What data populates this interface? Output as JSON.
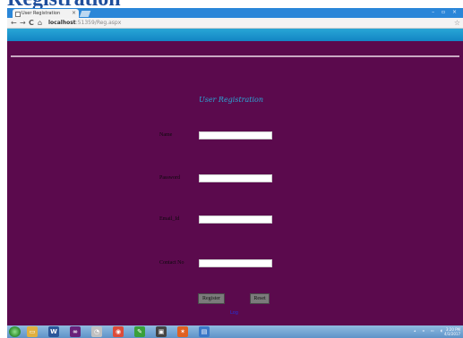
{
  "document": {
    "heading": "Registration"
  },
  "browser": {
    "tab_title": "User Registration",
    "tab_close": "×",
    "window_controls": "–  ▫  ×",
    "back": "←",
    "forward": "→",
    "reload": "C",
    "home": "⌂",
    "url_host": "localhost",
    "url_rest": ":51359/Reg.aspx",
    "star": "☆"
  },
  "page": {
    "title": "User Registration",
    "fields": [
      {
        "label": "Name",
        "value": ""
      },
      {
        "label": "Password",
        "value": ""
      },
      {
        "label": "Email_Id",
        "value": ""
      },
      {
        "label": "Contact No",
        "value": ""
      }
    ],
    "register_button": "Register",
    "reset_button": "Reset",
    "link_text": "Log"
  },
  "taskbar": {
    "apps": [
      {
        "icon": "folder-icon",
        "color": "#e0b040",
        "glyph": "▭"
      },
      {
        "icon": "word-icon",
        "color": "#2b579a",
        "glyph": "W"
      },
      {
        "icon": "visual-studio-icon",
        "color": "#68217a",
        "glyph": "∞"
      },
      {
        "icon": "sql-server-icon",
        "color": "#c0c0c0",
        "glyph": "◔"
      },
      {
        "icon": "chrome-icon",
        "color": "#dd4b39",
        "glyph": "◉"
      },
      {
        "icon": "paint-icon",
        "color": "#3aa03a",
        "glyph": "✎"
      },
      {
        "icon": "tool-icon",
        "color": "#444444",
        "glyph": "▣"
      },
      {
        "icon": "app-icon",
        "color": "#e06020",
        "glyph": "✶"
      },
      {
        "icon": "document-icon",
        "color": "#3a78c8",
        "glyph": "▤"
      }
    ],
    "clock_time": "3:20 PM",
    "clock_date": "4/3/2017"
  }
}
